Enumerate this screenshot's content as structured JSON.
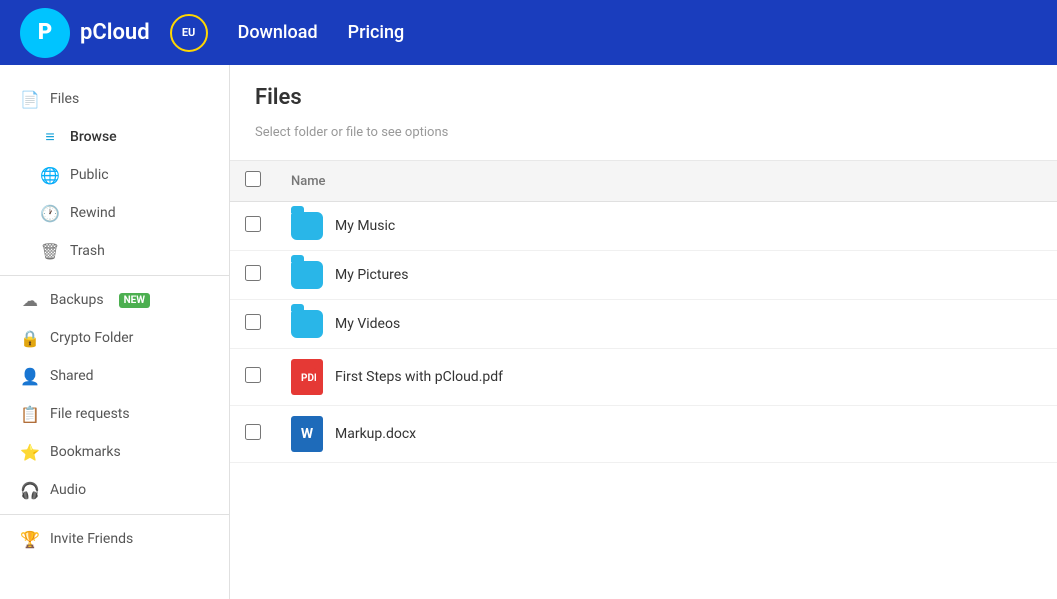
{
  "header": {
    "logo_text": "pCloud",
    "eu_label": "EU",
    "nav_items": [
      {
        "label": "Download",
        "id": "download"
      },
      {
        "label": "Pricing",
        "id": "pricing"
      }
    ]
  },
  "sidebar": {
    "items": [
      {
        "id": "files",
        "label": "Files",
        "icon": "📄",
        "level": 0
      },
      {
        "id": "browse",
        "label": "Browse",
        "icon": "≡",
        "level": 1,
        "active": true
      },
      {
        "id": "public",
        "label": "Public",
        "icon": "🌐",
        "level": 1
      },
      {
        "id": "rewind",
        "label": "Rewind",
        "icon": "🕐",
        "level": 1
      },
      {
        "id": "trash",
        "label": "Trash",
        "icon": "🗑",
        "level": 1
      },
      {
        "id": "backups",
        "label": "Backups",
        "icon": "☁",
        "level": 0,
        "badge": "NEW"
      },
      {
        "id": "crypto",
        "label": "Crypto Folder",
        "icon": "🔒",
        "level": 0
      },
      {
        "id": "shared",
        "label": "Shared",
        "icon": "👤",
        "level": 0
      },
      {
        "id": "file-requests",
        "label": "File requests",
        "icon": "📋",
        "level": 0
      },
      {
        "id": "bookmarks",
        "label": "Bookmarks",
        "icon": "⭐",
        "level": 0
      },
      {
        "id": "audio",
        "label": "Audio",
        "icon": "🎧",
        "level": 0
      },
      {
        "id": "invite",
        "label": "Invite Friends",
        "icon": "🏆",
        "level": 0
      }
    ]
  },
  "content": {
    "title": "Files",
    "select_hint": "Select folder or file to see options",
    "table_header": "Name",
    "files": [
      {
        "id": "my-music",
        "name": "My Music",
        "type": "folder"
      },
      {
        "id": "my-pictures",
        "name": "My Pictures",
        "type": "folder"
      },
      {
        "id": "my-videos",
        "name": "My Videos",
        "type": "folder"
      },
      {
        "id": "first-steps",
        "name": "First Steps with pCloud.pdf",
        "type": "pdf"
      },
      {
        "id": "markup",
        "name": "Markup.docx",
        "type": "docx"
      }
    ]
  }
}
